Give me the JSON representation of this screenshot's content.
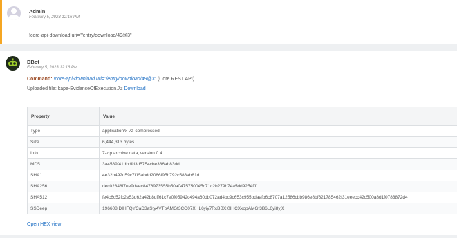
{
  "admin": {
    "author": "Admin",
    "time": "February 5, 2023 12:16 PM",
    "command": "!core-api-download uri=\"/entry/download/49@3\""
  },
  "bot": {
    "author": "DBot",
    "time": "February 5, 2023 12:16 PM",
    "command_label": "Command:",
    "command_link": "!core-api-download uri=\"/entry/download/49@3\"",
    "command_source": "(Core REST API)",
    "uploaded_label": "Uploaded file: kape-EvidenceOfExecution.7z",
    "download_link": "Download",
    "open_hex": "Open HEX view"
  },
  "table": {
    "headers": [
      "Property",
      "Value"
    ],
    "rows": [
      {
        "property": "Type",
        "value": "application/x-7z-compressed"
      },
      {
        "property": "Size",
        "value": "6,444,313 bytes"
      },
      {
        "property": "Info",
        "value": "7-zip archive data, version 0.4"
      },
      {
        "property": "MD5",
        "value": "3a4589f41dbdfd3d5754cbe386ab83dd"
      },
      {
        "property": "SHA1",
        "value": "4e32b492d59c7f15abdd2086f95b792c588ab81d"
      },
      {
        "property": "SHA256",
        "value": "dec02848f7ee9daec8476973555b50a0475750045c71c2b279b74a5dd9254fff"
      },
      {
        "property": "SHA512",
        "value": "fe4c6c52fc2e53d62a42b8dff61c7e0f05942c494a60db072ad4bc9c653c955bdaafb6c8707a12586cbb986e8bf621785462f31eeecc42c500a8d1f0783872d4"
      },
      {
        "property": "SSDeep",
        "value": "196608:DIHFQYCaD3aSty4VTpAMGf3CO07XHL6yiy7RcBBX:0IHCXxopAMGf3B6L6yi8yjX"
      }
    ]
  },
  "colors": {
    "admin_accent": "#f5a623",
    "link": "#1e6fc4",
    "command_label": "#a0522d"
  }
}
